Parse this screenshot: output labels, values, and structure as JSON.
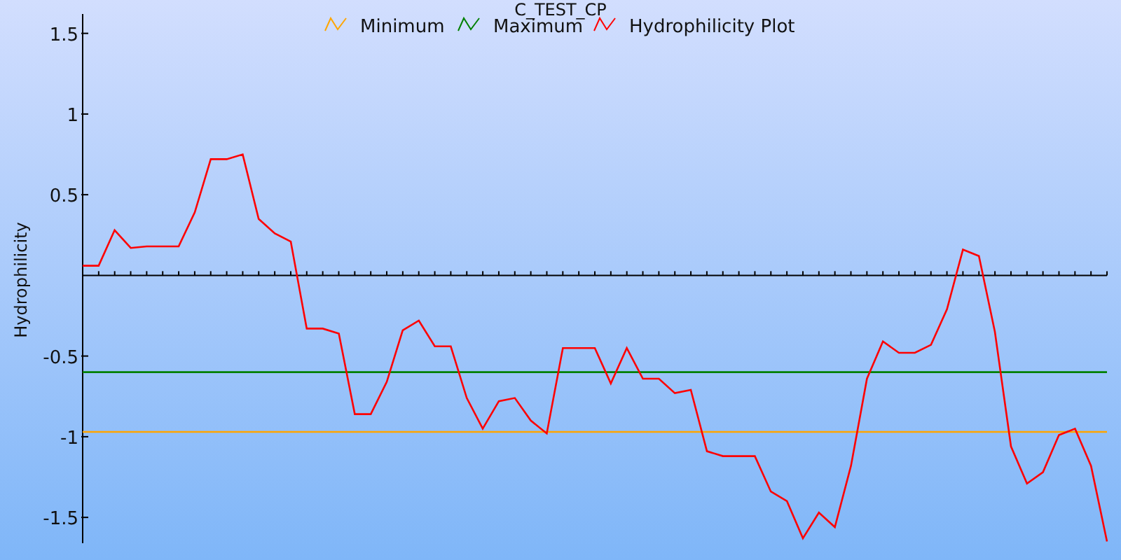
{
  "chart_data": {
    "type": "line",
    "title": "C_TEST_CP",
    "ylabel": "Hydrophilicity",
    "categories": [
      null,
      null,
      null,
      null,
      null,
      null,
      null,
      null,
      null,
      null,
      null,
      null,
      null,
      null,
      null,
      null,
      null,
      null,
      null,
      null,
      null,
      null,
      null,
      null,
      null,
      null,
      null,
      null,
      null,
      null,
      null,
      null,
      null,
      null,
      null,
      null,
      null,
      null,
      null,
      null,
      null,
      null,
      null,
      null,
      null,
      null,
      null,
      null,
      null,
      null,
      null,
      null,
      null,
      null,
      null,
      null,
      null,
      null,
      null,
      null,
      null,
      null,
      null,
      null,
      null
    ],
    "series": [
      {
        "name": "Minimum",
        "color": "#ffa500",
        "values": [
          -0.97,
          -0.97,
          -0.97,
          -0.97,
          -0.97,
          -0.97,
          -0.97,
          -0.97,
          -0.97,
          -0.97,
          -0.97,
          -0.97,
          -0.97,
          -0.97,
          -0.97,
          -0.97,
          -0.97,
          -0.97,
          -0.97,
          -0.97,
          -0.97,
          -0.97,
          -0.97,
          -0.97,
          -0.97,
          -0.97,
          -0.97,
          -0.97,
          -0.97,
          -0.97,
          -0.97,
          -0.97,
          -0.97,
          -0.97,
          -0.97,
          -0.97,
          -0.97,
          -0.97,
          -0.97,
          -0.97,
          -0.97,
          -0.97,
          -0.97,
          -0.97,
          -0.97,
          -0.97,
          -0.97,
          -0.97,
          -0.97,
          -0.97,
          -0.97,
          -0.97,
          -0.97,
          -0.97,
          -0.97,
          -0.97,
          -0.97,
          -0.97,
          -0.97,
          -0.97,
          -0.97,
          -0.97,
          -0.97,
          -0.97,
          -0.97
        ]
      },
      {
        "name": "Maximum",
        "color": "#008000",
        "values": [
          -0.6,
          -0.6,
          -0.6,
          -0.6,
          -0.6,
          -0.6,
          -0.6,
          -0.6,
          -0.6,
          -0.6,
          -0.6,
          -0.6,
          -0.6,
          -0.6,
          -0.6,
          -0.6,
          -0.6,
          -0.6,
          -0.6,
          -0.6,
          -0.6,
          -0.6,
          -0.6,
          -0.6,
          -0.6,
          -0.6,
          -0.6,
          -0.6,
          -0.6,
          -0.6,
          -0.6,
          -0.6,
          -0.6,
          -0.6,
          -0.6,
          -0.6,
          -0.6,
          -0.6,
          -0.6,
          -0.6,
          -0.6,
          -0.6,
          -0.6,
          -0.6,
          -0.6,
          -0.6,
          -0.6,
          -0.6,
          -0.6,
          -0.6,
          -0.6,
          -0.6,
          -0.6,
          -0.6,
          -0.6,
          -0.6,
          -0.6,
          -0.6,
          -0.6,
          -0.6,
          -0.6,
          -0.6,
          -0.6,
          -0.6,
          -0.6
        ]
      },
      {
        "name": "Hydrophilicity Plot",
        "color": "#ff0000",
        "values": [
          0.06,
          0.06,
          0.28,
          0.17,
          0.18,
          0.18,
          0.18,
          0.39,
          0.72,
          0.72,
          0.75,
          0.35,
          0.26,
          0.21,
          -0.33,
          -0.33,
          -0.36,
          -0.86,
          -0.86,
          -0.66,
          -0.34,
          -0.28,
          -0.44,
          -0.44,
          -0.76,
          -0.95,
          -0.78,
          -0.76,
          -0.9,
          -0.98,
          -0.45,
          -0.45,
          -0.45,
          -0.67,
          -0.45,
          -0.64,
          -0.64,
          -0.73,
          -0.71,
          -1.09,
          -1.12,
          -1.12,
          -1.12,
          -1.34,
          -1.4,
          -1.63,
          -1.47,
          -1.56,
          -1.18,
          -0.64,
          -0.41,
          -0.48,
          -0.48,
          -0.43,
          -0.21,
          0.16,
          0.12,
          -0.35,
          -1.06,
          -1.29,
          -1.22,
          -0.99,
          -0.95,
          -1.18,
          -1.65
        ]
      }
    ],
    "ylim": [
      -1.66,
      1.62
    ],
    "legend": "top",
    "yticks": [
      {
        "value": 1.5,
        "label": "1.5"
      },
      {
        "value": 1,
        "label": "1"
      },
      {
        "value": 0.5,
        "label": "0.5"
      },
      {
        "value": -0.5,
        "label": "-0.5"
      },
      {
        "value": -1,
        "label": "-1"
      },
      {
        "value": -1.5,
        "label": "-1.5"
      }
    ]
  }
}
